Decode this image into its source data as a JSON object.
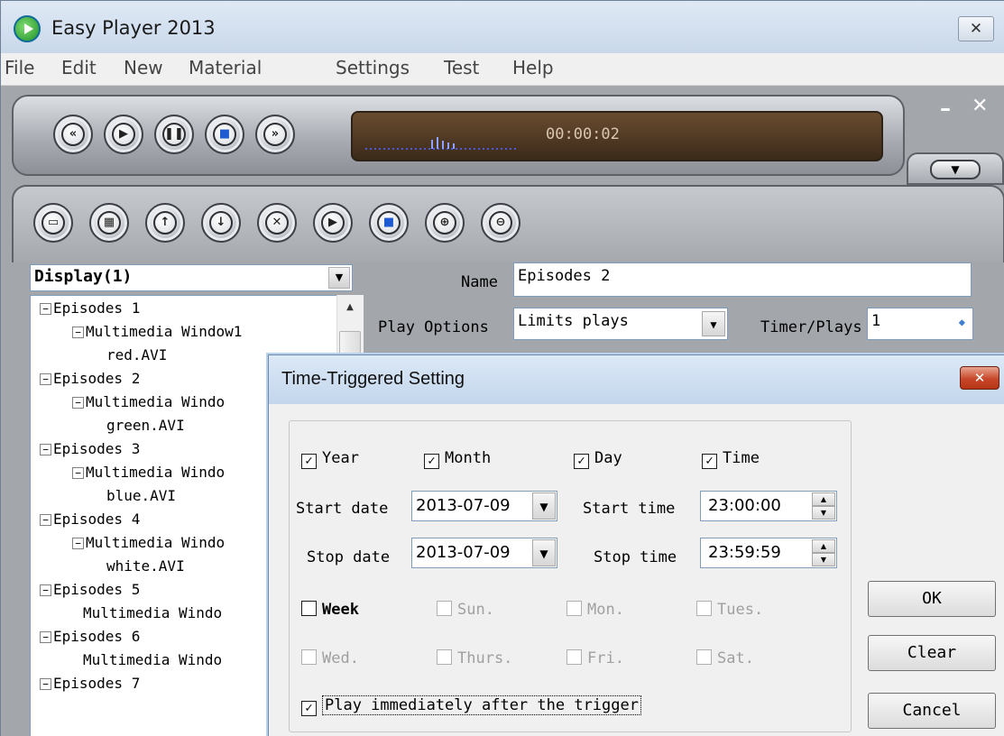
{
  "app": {
    "title": "Easy Player 2013",
    "close_glyph": "✕"
  },
  "menu": [
    "File",
    "Edit",
    "New",
    "Material",
    "Settings",
    "Test",
    "Help"
  ],
  "player": {
    "time": "00:00:02",
    "min_glyph": "–",
    "close_glyph": "✕"
  },
  "display_select": {
    "value": "Display(1)"
  },
  "tree": [
    {
      "label": "Episodes 1",
      "level": 0,
      "expander": "−"
    },
    {
      "label": "Multimedia Window1",
      "level": 1,
      "expander": "−"
    },
    {
      "label": "red.AVI",
      "level": 2
    },
    {
      "label": "Episodes 2",
      "level": 0,
      "expander": "−"
    },
    {
      "label": "Multimedia Windo",
      "level": 1,
      "expander": "−"
    },
    {
      "label": "green.AVI",
      "level": 2
    },
    {
      "label": "Episodes 3",
      "level": 0,
      "expander": "−"
    },
    {
      "label": "Multimedia Windo",
      "level": 1,
      "expander": "−"
    },
    {
      "label": "blue.AVI",
      "level": 2
    },
    {
      "label": "Episodes 4",
      "level": 0,
      "expander": "−"
    },
    {
      "label": "Multimedia Windo",
      "level": 1,
      "expander": "−"
    },
    {
      "label": "white.AVI",
      "level": 2
    },
    {
      "label": "Episodes 5",
      "level": 0,
      "expander": "−"
    },
    {
      "label": "Multimedia Windo",
      "level": 1
    },
    {
      "label": "Episodes 6",
      "level": 0,
      "expander": "−"
    },
    {
      "label": "Multimedia Windo",
      "level": 1
    },
    {
      "label": "Episodes 7",
      "level": 0,
      "expander": "−"
    }
  ],
  "props": {
    "name_label": "Name",
    "name_value": "Episodes 2",
    "play_options_label": "Play Options",
    "play_options_value": "Limits plays",
    "timer_label": "Timer/Plays",
    "timer_value": "1"
  },
  "dialog": {
    "title": "Time-Triggered Setting",
    "close_glyph": "✕",
    "year": {
      "label": "Year",
      "checked": true
    },
    "month": {
      "label": "Month",
      "checked": true
    },
    "day": {
      "label": "Day",
      "checked": true
    },
    "time": {
      "label": "Time",
      "checked": true
    },
    "start_date_label": "Start date",
    "start_date": "2013-07-09",
    "start_time_label": "Start time",
    "start_time": "23:00:00",
    "stop_date_label": "Stop date",
    "stop_date": "2013-07-09",
    "stop_time_label": "Stop time",
    "stop_time": "23:59:59",
    "week": {
      "label": "Week",
      "checked": false
    },
    "days": [
      "Sun.",
      "Mon.",
      "Tues.",
      "Wed.",
      "Thurs.",
      "Fri.",
      "Sat."
    ],
    "play_immediately": {
      "label": "Play immediately after the trigger",
      "checked": true
    },
    "ok": "OK",
    "clear": "Clear",
    "cancel": "Cancel"
  }
}
